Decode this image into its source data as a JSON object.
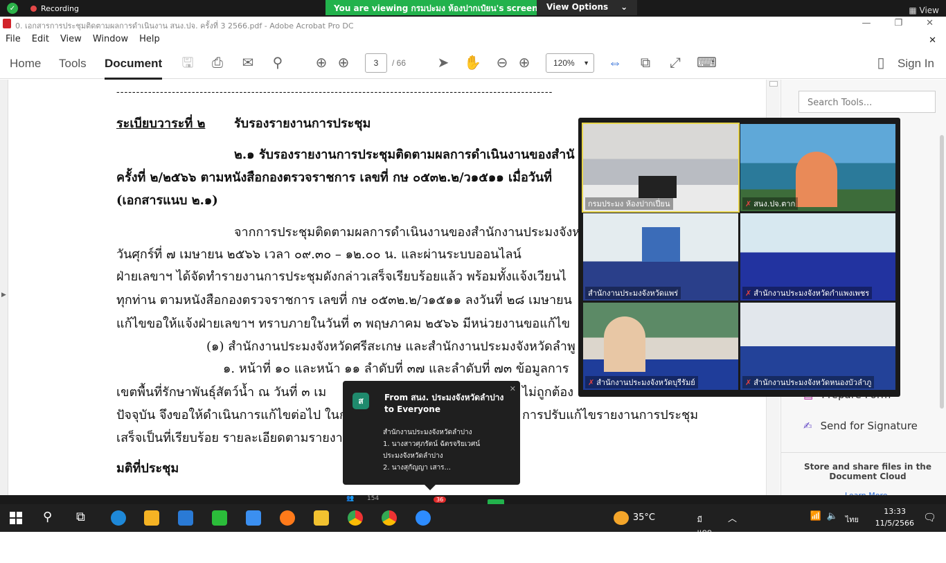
{
  "zoom_bar": {
    "recording": "Recording",
    "viewing": "You are viewing กรมปะมง ห้องปากเป๋ยน's screen",
    "view_options": "View Options",
    "view": "View"
  },
  "window": {
    "title": "0. เอกสารการประชุมติดตามผลการดำเนินงาน สนง.ปจ. ครั้งที่ 3 2566.pdf - Adobe Acrobat Pro DC"
  },
  "menu": [
    "File",
    "Edit",
    "View",
    "Window",
    "Help"
  ],
  "toolbar": {
    "tabs": [
      "Home",
      "Tools",
      "Document"
    ],
    "page_current": "3",
    "page_total": "/ 66",
    "zoom": "120%",
    "sign_in": "Sign In"
  },
  "document": {
    "dash_line": "--------------------------------------------------------------------------------------------------------------",
    "agenda_title": "ระเบียบวาระที่ ๒",
    "agenda_subject": "รับรองรายงานการประชุม",
    "p1_l1": "๒.๑  รับรองรายงานการประชุมติดตามผลการดำเนินงานของสำนั",
    "p1_l2": "ครั้งที่ ๒/๒๕๖๖ ตามหนังสือกองตรวจราชการ เลขที่ กษ ๐๕๓๒.๒/ว๑๕๑๑ เมื่อวันที่",
    "p1_l3": "(เอกสารแนบ ๒.๑)",
    "p2_l1": "จากการประชุมติดตามผลการดำเนินงานของสำนักงานประมงจังห",
    "p2_l2": "วันศุกร์ที่ ๗ เมษายน ๒๕๖๖ เวลา ๐๙.๓๐ – ๑๒.๐๐ น. และผ่านระบบออนไลน์",
    "p2_l3": "ฝ่ายเลขาฯ ได้จัดทำรายงานการประชุมดังกล่าวเสร็จเรียบร้อยแล้ว พร้อมทั้งแจ้งเวียนไ",
    "p2_l4": "ทุกท่าน ตามหนังสือกองตรวจราชการ เลขที่ กษ ๐๕๓๒.๒/ว๑๕๑๑ ลงวันที่ ๒๘ เมษายน",
    "p2_l5": "แก้ไขขอให้แจ้งฝ่ายเลขาฯ ทราบภายในวันที่ ๓ พฤษภาคม ๒๕๖๖ มีหน่วยงานขอแก้ไข",
    "p3_l1": "(๑) สำนักงานประมงจังหวัดศรีสะเกษ และสำนักงานประมงจังหวัดลำพู",
    "p3_l2": "๑. หน้าที่ ๑๐ และหน้า ๑๑ ลำดับที่ ๓๗ และลำดับที่ ๗๓ ข้อมูลการ",
    "p3_l3a": "เขตพื้นที่รักษาพันธุ์สัตว์น้ำ ณ วันที่ ๓ เม",
    "p3_l3b": "ไม่ถูกต้อง",
    "p3_l4a": "ปัจจุบัน จึงขอให้ดำเนินการแก้ไขต่อไป ในก",
    "p3_l4b": "การปรับแก้ไขรายงานการประชุม",
    "p3_l5": "เสร็จเป็นที่เรียบร้อย รายละเอียดตามรายงา",
    "resolution": "มติที่ประชุม"
  },
  "right_panel": {
    "search_placeholder": "Search Tools...",
    "prepare_form": "Prepare Form",
    "send_signature": "Send for Signature",
    "store": "Store and share files in the Document Cloud",
    "learn_more": "Learn More"
  },
  "video_tiles": [
    {
      "label": "กรมประมง ห้องปากเปี่ยน",
      "muted": false
    },
    {
      "label": "สนง.ปจ.ตาก",
      "muted": true
    },
    {
      "label": "สำนักงานประมงจังหวัดแพร่",
      "muted": false
    },
    {
      "label": "สำนักงานประมงจังหวัดกำแพงเพชร",
      "muted": true
    },
    {
      "label": "สำนักงานประมงจังหวัดบุรีรัมย์",
      "muted": true
    },
    {
      "label": "สำนักงานประมงจังหวัดหนองบัวลำภู",
      "muted": true
    }
  ],
  "chat": {
    "avatar": "ส",
    "header": "From สนง. ประมงจังหวัดลำปาง to Everyone",
    "l1": "สำนักงานประมงจังหวัดลำปาง",
    "l2": "1. นางสาวศุภรัตน์  ฉัตรจริยเวศน์",
    "l3": "ประมงจังหวัดลำปาง",
    "l4": "2. นางสุกัญญา  เสาร..."
  },
  "zoom_controls": {
    "participants": "154",
    "chat_badge": "36"
  },
  "taskbar": {
    "weather_temp": "35°C",
    "weather_text": "มีแดดบางส่วน",
    "lang": "ไทย",
    "time": "13:33",
    "date": "11/5/2566"
  },
  "colors": {
    "zoom_green": "#22b24c",
    "active_border": "#e7d54c",
    "chat_bg": "#1f1f1f",
    "taskbar": "#202020"
  }
}
